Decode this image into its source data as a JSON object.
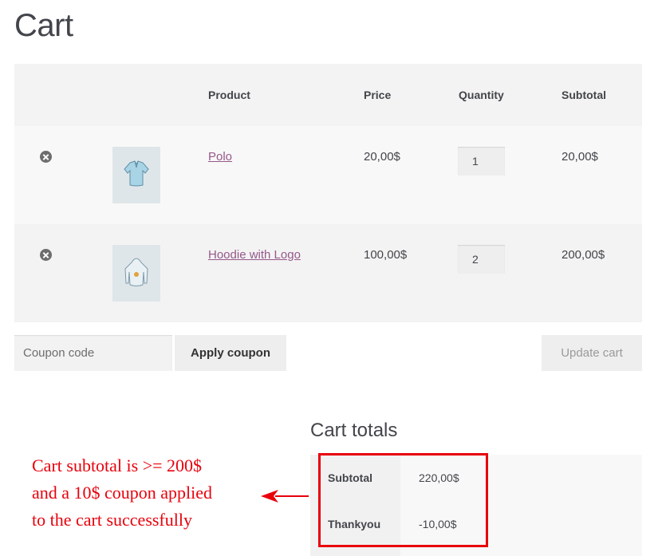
{
  "page": {
    "title": "Cart"
  },
  "table": {
    "headers": {
      "product": "Product",
      "price": "Price",
      "quantity": "Quantity",
      "subtotal": "Subtotal"
    },
    "rows": [
      {
        "name": "Polo",
        "price": "20,00$",
        "quantity": "1",
        "subtotal": "20,00$"
      },
      {
        "name": "Hoodie with Logo",
        "price": "100,00$",
        "quantity": "2",
        "subtotal": "200,00$"
      }
    ]
  },
  "actions": {
    "coupon_placeholder": "Coupon code",
    "apply_coupon": "Apply coupon",
    "update_cart": "Update cart"
  },
  "totals": {
    "title": "Cart totals",
    "rows": [
      {
        "label": "Subtotal",
        "value": "220,00$"
      },
      {
        "label": "Thankyou",
        "value": "-10,00$"
      }
    ]
  },
  "annotation": {
    "lines": [
      "Cart subtotal is >= 200$",
      "and a 10$ coupon applied",
      "to the cart successfully"
    ],
    "color": "#e8000b"
  },
  "colors": {
    "link": "#96588a",
    "text": "#43454b",
    "highlight": "#e8000b"
  },
  "icons": {
    "remove": "remove-item-icon",
    "arrow": "left-arrow-icon"
  }
}
